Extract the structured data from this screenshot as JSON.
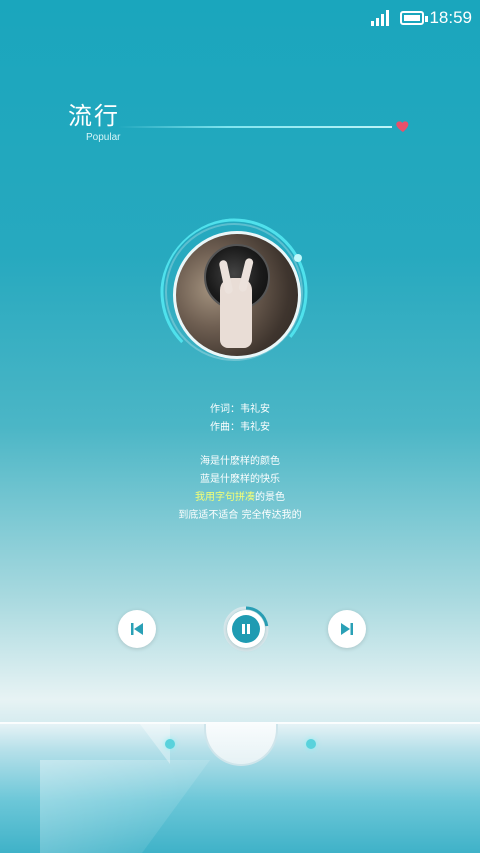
{
  "status_bar": {
    "time": "18:59",
    "icons": [
      "signal-icon",
      "battery-icon"
    ]
  },
  "header": {
    "title": "流行",
    "subtitle": "Popular",
    "favorite_icon": "heart-icon",
    "accent_color": "#e9506a"
  },
  "player": {
    "album_art_icon": "album-art",
    "credits": [
      "作词：韦礼安",
      "作曲：韦礼安"
    ],
    "lyrics": [
      {
        "text": "海是什麽样的颜色",
        "highlight": false
      },
      {
        "text": "蓝是什麽样的快乐",
        "highlight": false
      },
      {
        "highlight_prefix": "我用字句拼凑",
        "suffix": "的景色"
      },
      {
        "text": "到底适不适合 完全传达我的",
        "highlight": false
      }
    ],
    "controls": {
      "prev_icon": "skip-previous-icon",
      "play_pause_icon": "pause-icon",
      "next_icon": "skip-next-icon"
    },
    "accent_color": "#2aa0b6"
  },
  "dock": {
    "left_dot": "page-dot",
    "right_dot": "page-dot"
  }
}
